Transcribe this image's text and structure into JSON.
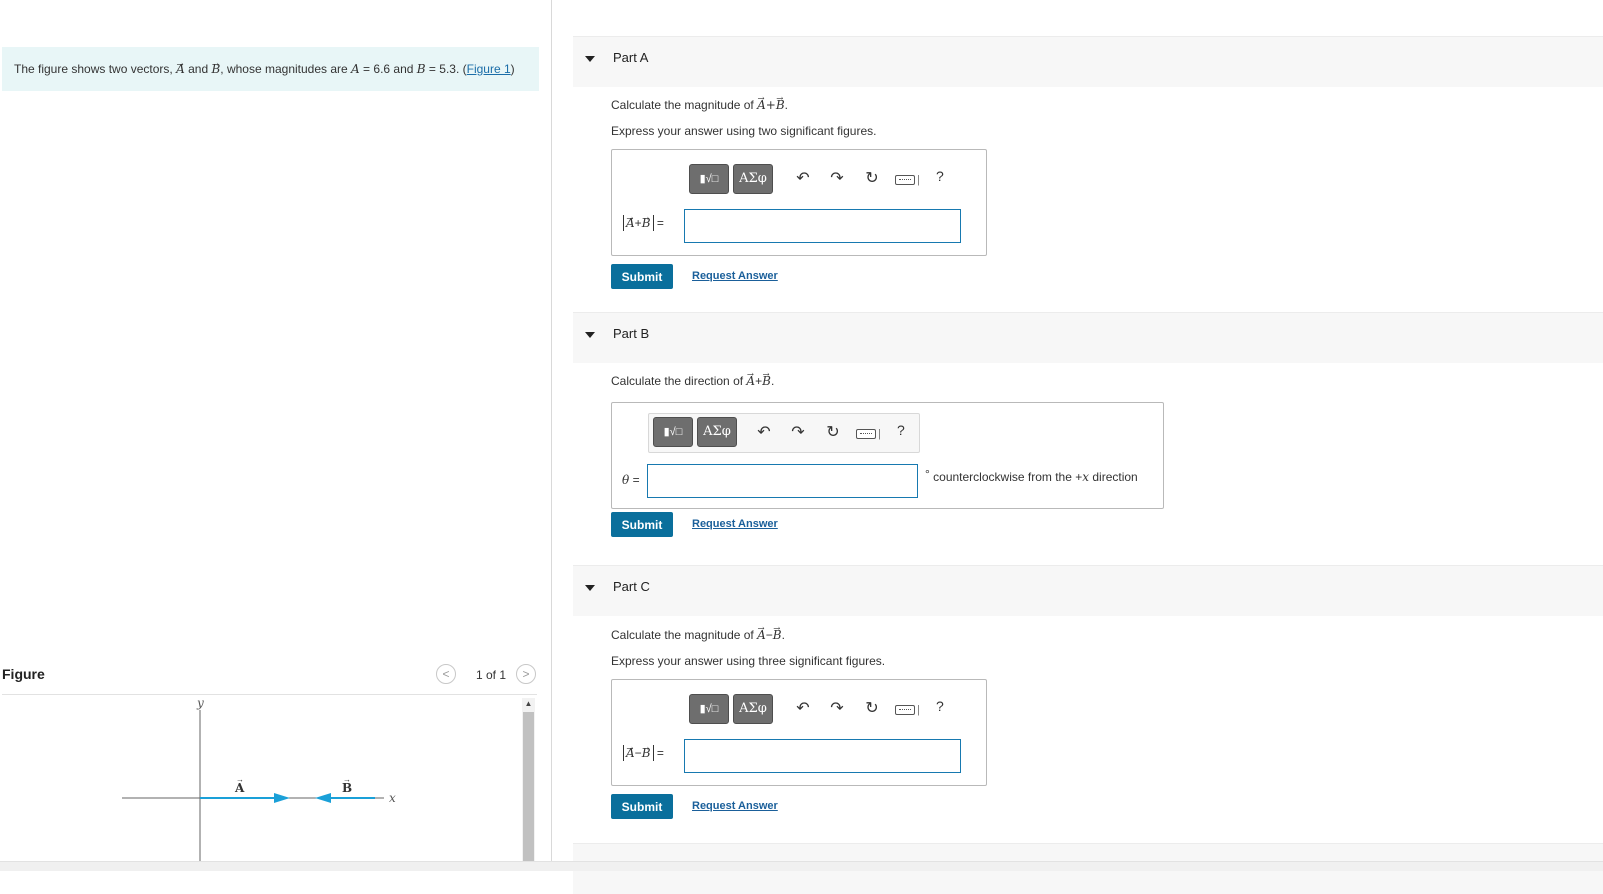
{
  "problem": {
    "intro": "The figure shows two vectors,",
    "vec_a": "A",
    "and_word": "and",
    "vec_b": "B",
    "mag_text": ", whose magnitudes are",
    "a_sym": "A",
    "a_val": " = 6.6 and ",
    "b_sym": "B",
    "b_val": " = 5.3.",
    "link_open": "(",
    "figure_link": "Figure 1",
    "link_close": ")"
  },
  "figure": {
    "title": "Figure",
    "prev_label": "<",
    "next_label": ">",
    "page_counter": "1 of 1",
    "axis_y": "y",
    "axis_x": "x",
    "label_a": "A",
    "label_b": "B",
    "vector_color": "#1aa0d8"
  },
  "toolbar": {
    "templates_label": "▮√□",
    "greek_label": "ΑΣφ",
    "sep": "|",
    "help_label": "?"
  },
  "part_a": {
    "title": "Part A",
    "prompt_text": "Calculate the magnitude of",
    "vec_a": "A",
    "op": "+",
    "vec_b": "B",
    "period": ".",
    "instruction": "Express your answer using two significant figures.",
    "label_eq": "=",
    "input_value": "",
    "submit_label": "Submit",
    "request_label": "Request Answer"
  },
  "part_b": {
    "title": "Part B",
    "prompt_text": "Calculate the direction of",
    "vec_a": "A",
    "op": "+",
    "vec_b": "B",
    "period": ".",
    "theta": "θ",
    "label_eq": " =",
    "input_value": "",
    "unit_degree": "°",
    "unit_text": "counterclockwise from the",
    "unit_plus": "+",
    "unit_x": "x",
    "unit_direction": "direction",
    "submit_label": "Submit",
    "request_label": "Request Answer"
  },
  "part_c": {
    "title": "Part C",
    "prompt_text": "Calculate the magnitude of",
    "vec_a": "A",
    "op": "−",
    "vec_b": "B",
    "period": ".",
    "instruction": "Express your answer using three significant figures.",
    "label_eq": "=",
    "input_value": "",
    "submit_label": "Submit",
    "request_label": "Request Answer"
  },
  "colors": {
    "accent": "#0a6f9c",
    "problem_bg": "#e8f6f7",
    "input_border": "#1779b0"
  }
}
